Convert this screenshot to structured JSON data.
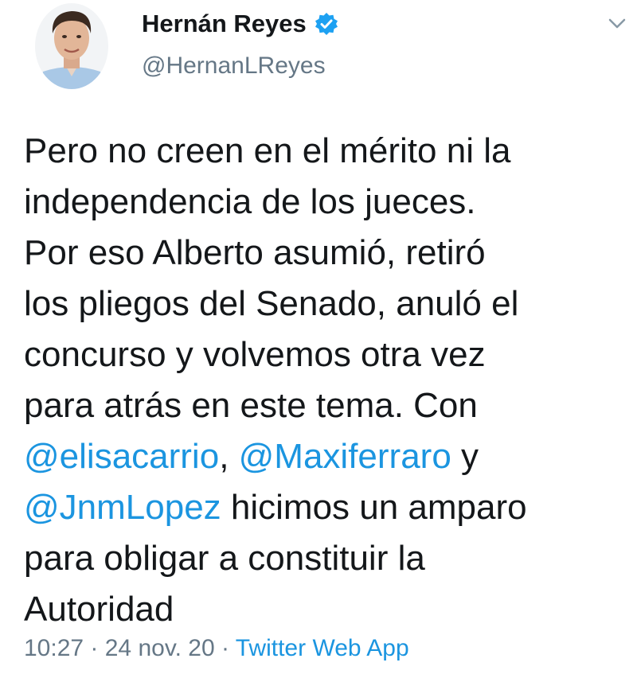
{
  "author": {
    "display_name": "Hernán Reyes",
    "handle": "@HernanLReyes",
    "verified_icon": "verified-badge-icon",
    "avatar_icon": "profile-photo"
  },
  "menu": {
    "icon": "chevron-down-icon"
  },
  "tweet": {
    "line1": "Pero no creen en el mérito ni la",
    "line2": "independencia de los jueces.",
    "line3": "Por eso Alberto asumió, retiró",
    "line4": "los pliegos del Senado, anuló el",
    "line5": "concurso y volvemos otra vez",
    "line6": "para atrás en este tema. Con",
    "mention1": "@elisacarrio",
    "sep1": ", ",
    "mention2": "@Maxiferraro",
    "sep2": " y",
    "mention3": "@JnmLopez",
    "line8_rest": " hicimos un amparo",
    "line9": "para obligar a constituir la",
    "line10": "Autoridad"
  },
  "meta": {
    "time": "10:27",
    "dot1": " · ",
    "date": "24 nov. 20",
    "dot2": " · ",
    "source": "Twitter Web App"
  },
  "colors": {
    "link": "#1b95e0",
    "secondary_text": "#657786",
    "primary_text": "#14171a",
    "verified": "#1da1f2"
  }
}
